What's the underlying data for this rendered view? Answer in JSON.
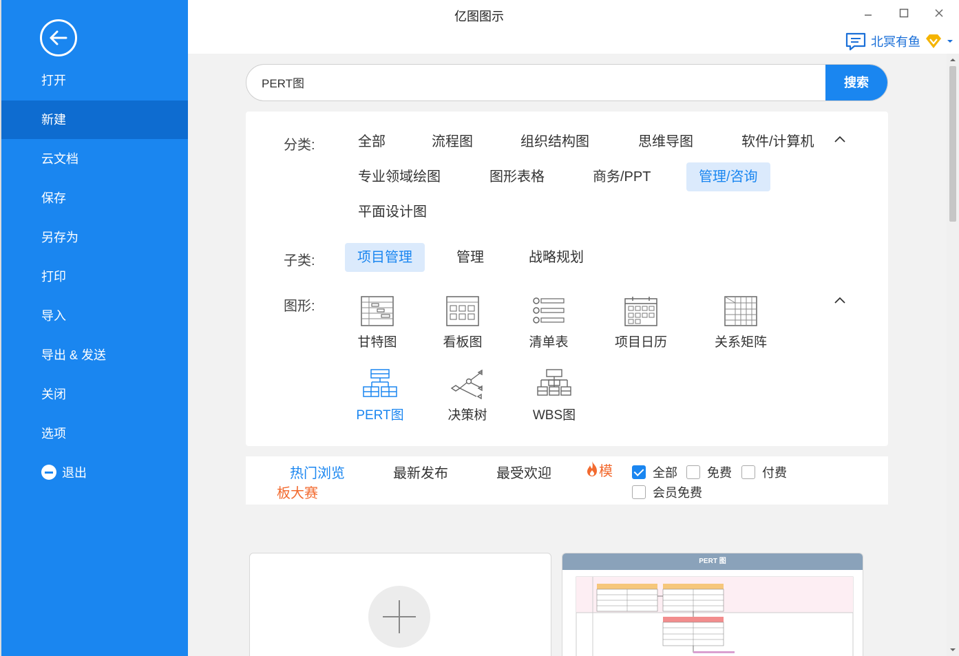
{
  "app": {
    "title": "亿图图示",
    "user_name": "北冥有鱼"
  },
  "sidebar": {
    "items": [
      {
        "label": "打开"
      },
      {
        "label": "新建"
      },
      {
        "label": "云文档"
      },
      {
        "label": "保存"
      },
      {
        "label": "另存为"
      },
      {
        "label": "打印"
      },
      {
        "label": "导入"
      },
      {
        "label": "导出 & 发送"
      },
      {
        "label": "关闭"
      },
      {
        "label": "选项"
      },
      {
        "label": "退出"
      }
    ],
    "active_index": 1
  },
  "search": {
    "value": "PERT图",
    "button": "搜索"
  },
  "categories": {
    "label": "分类:",
    "items": [
      "全部",
      "流程图",
      "组织结构图",
      "思维导图",
      "软件/计算机",
      "专业领域绘图",
      "图形表格",
      "商务/PPT",
      "管理/咨询",
      "平面设计图"
    ],
    "active": "管理/咨询"
  },
  "subcategories": {
    "label": "子类:",
    "items": [
      "项目管理",
      "管理",
      "战略规划"
    ],
    "active": "项目管理"
  },
  "shapes": {
    "label": "图形:",
    "items": [
      "甘特图",
      "看板图",
      "清单表",
      "项目日历",
      "关系矩阵",
      "PERT图",
      "决策树",
      "WBS图"
    ],
    "active": "PERT图"
  },
  "filter": {
    "tabs": [
      "热门浏览",
      "最新发布",
      "最受欢迎"
    ],
    "active_tab": "热门浏览",
    "contest_line1": "模",
    "contest_line2": "板大赛",
    "checkboxes": [
      {
        "label": "全部",
        "checked": true
      },
      {
        "label": "免费",
        "checked": false
      },
      {
        "label": "付费",
        "checked": false
      },
      {
        "label": "会员免费",
        "checked": false
      }
    ]
  },
  "templates": {
    "preview_title": "PERT 图"
  },
  "colors": {
    "accent": "#1a86f0",
    "sidebar_active": "#0e6cd0",
    "hot": "#f26a2f",
    "vip": "#f5b400"
  }
}
